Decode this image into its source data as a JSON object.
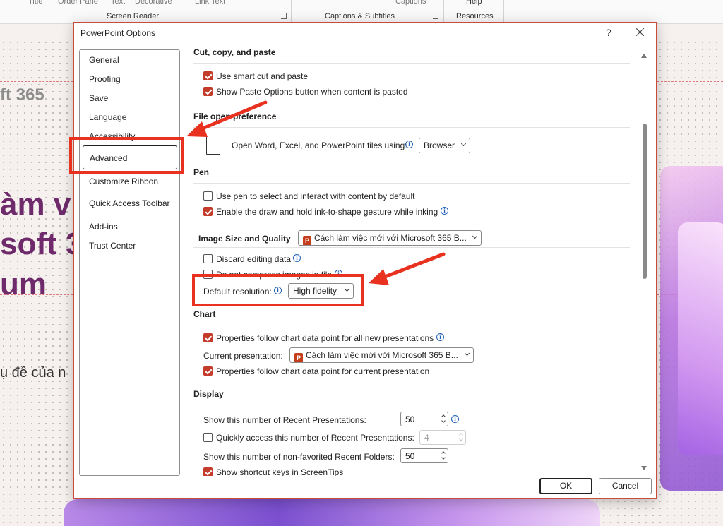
{
  "ribbon": {
    "items": [
      "Title",
      "Order Pane",
      "Text",
      "Decorative",
      "Link Text",
      "Captions",
      "Help"
    ],
    "groups": [
      "Screen Reader",
      "Captions & Subtitles",
      "Resources"
    ]
  },
  "slide": {
    "texts": [
      "ft 365",
      "àm vi",
      "soft 3",
      "um",
      "ụ đề của n"
    ]
  },
  "dialog": {
    "title": "PowerPoint Options",
    "help": "?"
  },
  "nav": {
    "items": [
      "General",
      "Proofing",
      "Save",
      "Language",
      "Accessibility",
      "Advanced",
      "Customize Ribbon",
      "Quick Access Toolbar",
      "Add-ins",
      "Trust Center"
    ],
    "selected": "Advanced"
  },
  "sections": {
    "cut": {
      "title": "Cut, copy, and paste",
      "opt1": "Use smart cut and paste",
      "opt2": "Show Paste Options button when content is pasted"
    },
    "fileopen": {
      "title": "File open preference",
      "label": "Open Word, Excel, and PowerPoint files using:",
      "value": "Browser"
    },
    "pen": {
      "title": "Pen",
      "opt1": "Use pen to select and interact with content by default",
      "opt2": "Enable the draw and hold ink-to-shape gesture while inking"
    },
    "image": {
      "title": "Image Size and Quality",
      "presentation": "Cách làm việc mới với Microsoft 365 B...",
      "opt1": "Discard editing data",
      "opt2": "Do not compress images in file",
      "res_label": "Default resolution:",
      "res_value": "High fidelity"
    },
    "chart": {
      "title": "Chart",
      "opt1": "Properties follow chart data point for all new presentations",
      "current_label": "Current presentation:",
      "current_value": "Cách làm việc mới với Microsoft 365 B...",
      "opt2": "Properties follow chart data point for current presentation"
    },
    "display": {
      "title": "Display",
      "recent_label": "Show this number of Recent Presentations:",
      "recent_value": "50",
      "quick_label": "Quickly access this number of Recent Presentations:",
      "quick_value": "4",
      "folders_label": "Show this number of non-favorited Recent Folders:",
      "folders_value": "50",
      "shortcut_label": "Show shortcut keys in ScreenTips"
    }
  },
  "buttons": {
    "ok": "OK",
    "cancel": "Cancel"
  },
  "colors": {
    "accent_checkbox": "#c33b2a",
    "annotation_red": "#e8311e"
  }
}
